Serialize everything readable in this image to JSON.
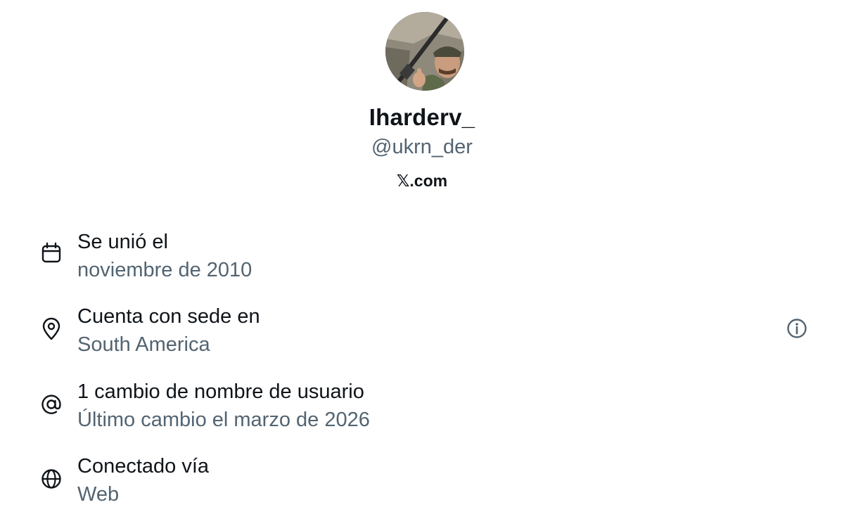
{
  "profile": {
    "display_name": "Iharderv_",
    "handle": "@ukrn_der",
    "site_prefix": "𝕏",
    "site_suffix": ".com"
  },
  "rows": [
    {
      "icon": "calendar-icon",
      "title": "Se unió el",
      "subtitle": "noviembre de 2010"
    },
    {
      "icon": "location-pin-icon",
      "title": "Cuenta con sede en",
      "subtitle": "South America"
    },
    {
      "icon": "at-sign-icon",
      "title": "1 cambio de nombre de usuario",
      "subtitle": "Último cambio el marzo de 2026"
    },
    {
      "icon": "globe-icon",
      "title": "Conectado vía",
      "subtitle": "Web"
    }
  ],
  "info_button_icon": "info-icon",
  "colors": {
    "primary_text": "#0f1419",
    "secondary_text": "#536471",
    "background": "#ffffff"
  }
}
